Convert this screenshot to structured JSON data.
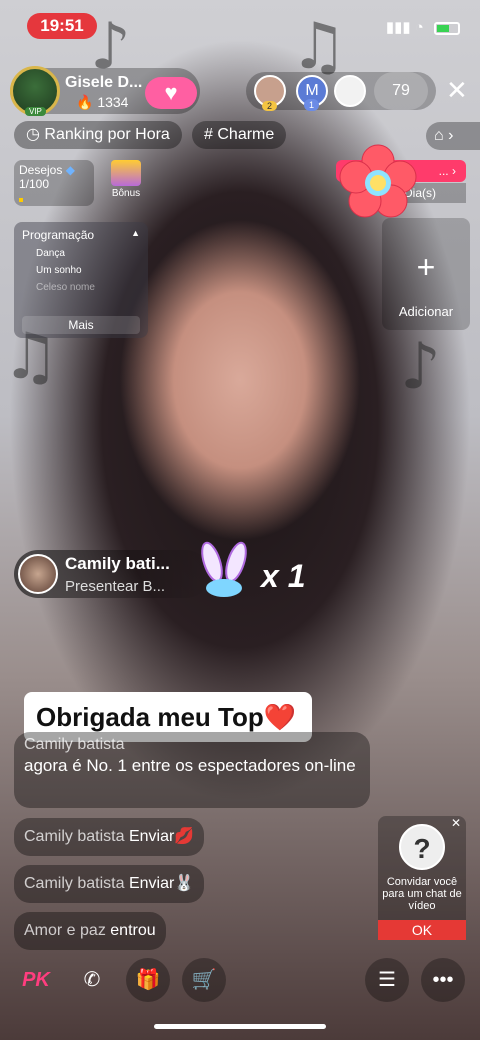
{
  "status_bar": {
    "time": "19:51"
  },
  "host": {
    "name": "Gisele D...",
    "vip_label": "VIP",
    "fans": "1334"
  },
  "viewers": {
    "avatars": [
      {
        "badge": "2",
        "color": "#f5c542"
      },
      {
        "letter": "M",
        "badge": "1",
        "color": "#5b7bd5"
      },
      {
        "badge": "",
        "color": "#ffffff"
      }
    ],
    "count": "79"
  },
  "top_pills": {
    "ranking": "Ranking por Hora",
    "tag": "Charme"
  },
  "wishes": {
    "label": "Desejos",
    "progress": "1/100",
    "progress_fraction": 0.01
  },
  "bonus": {
    "label": "Bônus"
  },
  "program": {
    "title": "Programação",
    "items": [
      "Dança",
      "Um sonho",
      "Celeso nome"
    ],
    "more": "Mais"
  },
  "event": {
    "banner": "...",
    "days": "Dia(s)"
  },
  "add_box": {
    "label": "Adicionar"
  },
  "gift": {
    "sender": "Camily bati...",
    "action": "Presentear B...",
    "count": "x 1"
  },
  "thanks_sticker": {
    "text": "Obrigada meu Top❤️"
  },
  "chat": [
    {
      "user": "Camily batista",
      "msg": "agora é No. 1 entre os espectadores on-line"
    },
    {
      "user": "Camily batista",
      "msg": "Enviar💋"
    },
    {
      "user": "Camily batista",
      "msg": "Enviar🐰"
    },
    {
      "user": "Amor e paz",
      "msg": "entrou"
    }
  ],
  "invite": {
    "text": "Convidar você para um chat de vídeo",
    "ok": "OK"
  },
  "bottom_bar": {
    "pk": "PK"
  }
}
